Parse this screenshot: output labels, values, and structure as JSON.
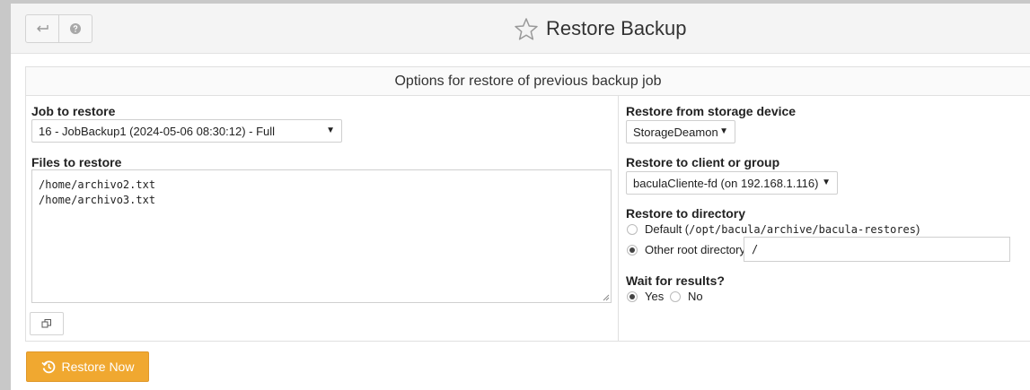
{
  "header": {
    "title": "Restore Backup",
    "back_icon": "back-arrow-icon",
    "help_icon": "help-icon",
    "favorite_icon": "star-icon"
  },
  "panel": {
    "heading": "Options for restore of previous backup job"
  },
  "left": {
    "job_label": "Job to restore",
    "job_value": "16 - JobBackup1 (2024-05-06 08:30:12) - Full",
    "files_label": "Files to restore",
    "files": [
      "/home/archivo2.txt",
      "/home/archivo3.txt"
    ]
  },
  "right": {
    "storage_label": "Restore from storage device",
    "storage_value": "StorageDeamon",
    "client_label": "Restore to client or group",
    "client_value": "baculaCliente-fd (on 192.168.1.116)",
    "directory_label": "Restore to directory",
    "default_dir_prefix": "Default (",
    "default_dir_path": "/opt/bacula/archive/bacula-restores",
    "default_dir_suffix": ")",
    "other_dir_label": "Other root directory",
    "other_dir_value": "/",
    "wait_label": "Wait for results?",
    "wait_yes": "Yes",
    "wait_no": "No"
  },
  "actions": {
    "restore_label": "Restore Now"
  },
  "colors": {
    "accent": "#f0a830",
    "header_bg": "#f4f4f4"
  }
}
